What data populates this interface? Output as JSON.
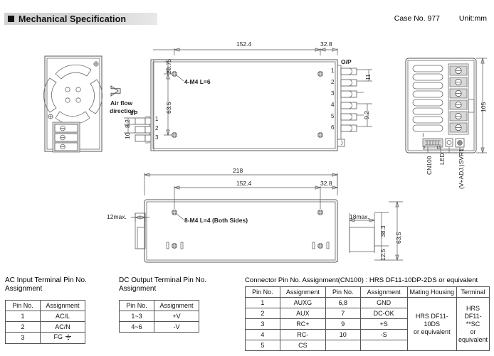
{
  "header": {
    "title": "Mechanical Specification",
    "case_no": "Case No. 977",
    "unit": "Unit:mm"
  },
  "drawing": {
    "views": {
      "front_left": {
        "name": "fan-side-view"
      },
      "top": {
        "name": "top-view"
      },
      "side_right": {
        "name": "right-side-view"
      },
      "bottom": {
        "name": "bottom-view"
      }
    },
    "airflow_label_line1": "Air flow",
    "airflow_label_line2": "direction",
    "labels": {
      "ip": "I/P",
      "op": "O/P",
      "screw_top": "4-M4 L=6",
      "screw_bottom": "8-M4 L=4 (Both Sides)",
      "cn100": "CN100",
      "led": "LED",
      "adj": "(V+ADJ.)SVR1"
    },
    "dimensions": {
      "top_152_4": "152.4",
      "top_32_8": "32.8",
      "v_20_75": "20.75",
      "v_63_5": "63.5",
      "ip_8_2": "8.2",
      "ip_10": "10",
      "op_11": "11",
      "op_9_2": "9.2",
      "side_105": "105",
      "bot_218": "218",
      "bot_152_4": "152.4",
      "bot_32_8": "32.8",
      "bot_12max": "12max.",
      "bot_18max": "18max.",
      "bot_38_3": "38.3",
      "bot_12_5": "12.5",
      "bot_63_5": "63.5"
    },
    "ip_pins": [
      "1",
      "2",
      "3"
    ],
    "op_pins": [
      "1",
      "2",
      "3",
      "4",
      "5",
      "6"
    ],
    "cn100_pin_marks": [
      "1",
      "2",
      "10"
    ]
  },
  "tables": {
    "ac_input": {
      "caption": "AC Input Terminal Pin No.\nAssignment",
      "headers": [
        "Pin No.",
        "Assignment"
      ],
      "rows": [
        [
          "1",
          "AC/L"
        ],
        [
          "2",
          "AC/N"
        ],
        [
          "3",
          "FG"
        ]
      ]
    },
    "dc_output": {
      "caption": "DC Output Terminal Pin No.\nAssignment",
      "headers": [
        "Pin No.",
        "Assignment"
      ],
      "rows": [
        [
          "1~3",
          "+V"
        ],
        [
          "4~6",
          "-V"
        ]
      ]
    },
    "connector": {
      "caption": "Connector Pin No. Assignment(CN100) : HRS DF11-10DP-2DS or equivalent",
      "headers": [
        "Pin No.",
        "Assignment",
        "Pin No.",
        "Assignment",
        "Mating Housing",
        "Terminal"
      ],
      "rows": [
        [
          "1",
          "AUXG",
          "6,8",
          "GND"
        ],
        [
          "2",
          "AUX",
          "7",
          "DC-OK"
        ],
        [
          "3",
          "RC+",
          "9",
          "+S"
        ],
        [
          "4",
          "RC-",
          "10",
          "-S"
        ],
        [
          "5",
          "CS",
          "",
          ""
        ]
      ],
      "mating_housing": "HRS DF11-10DS\nor equivalent",
      "terminal": "HRS DF11-**SC\nor equivalent"
    }
  }
}
